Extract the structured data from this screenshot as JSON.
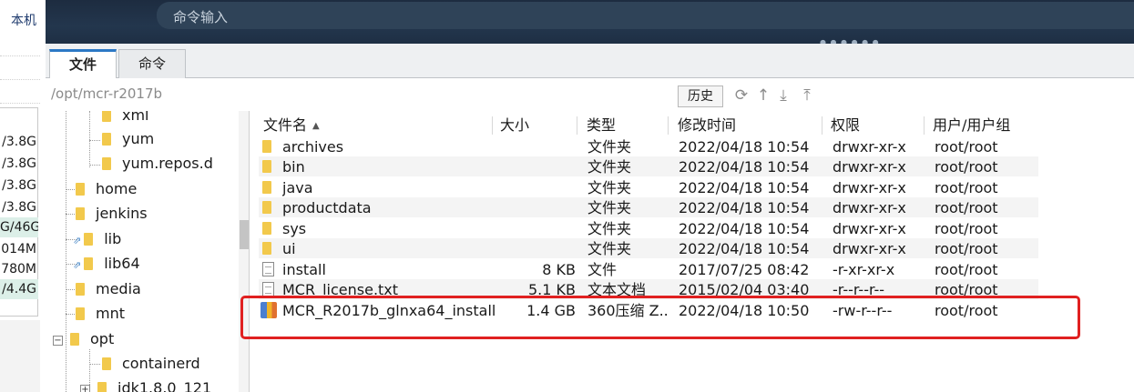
{
  "left_panel": {
    "label": "本机",
    "rows": [
      "/3.8G",
      "/3.8G",
      "/3.8G",
      "/3.8G",
      "G/46G",
      "014M",
      "780M",
      "/4.4G"
    ]
  },
  "command_bar": {
    "placeholder": "命令输入"
  },
  "tabs": [
    {
      "label": "文件",
      "active": true
    },
    {
      "label": "命令",
      "active": false
    }
  ],
  "path": {
    "current": "/opt/mcr-r2017b",
    "history_label": "历史",
    "tool_icons": [
      "refresh-icon",
      "up-directory-icon",
      "download-icon",
      "upload-icon"
    ]
  },
  "tree": [
    {
      "label": "xml",
      "level": 2,
      "kind": "folder"
    },
    {
      "label": "yum",
      "level": 2,
      "kind": "folder"
    },
    {
      "label": "yum.repos.d",
      "level": 2,
      "kind": "folder"
    },
    {
      "label": "home",
      "level": 1,
      "kind": "folder"
    },
    {
      "label": "jenkins",
      "level": 1,
      "kind": "folder"
    },
    {
      "label": "lib",
      "level": 1,
      "kind": "link"
    },
    {
      "label": "lib64",
      "level": 1,
      "kind": "link"
    },
    {
      "label": "media",
      "level": 1,
      "kind": "folder"
    },
    {
      "label": "mnt",
      "level": 1,
      "kind": "folder"
    },
    {
      "label": "opt",
      "level": 1,
      "kind": "folder-expanded"
    },
    {
      "label": "containerd",
      "level": 2,
      "kind": "folder"
    },
    {
      "label": "jdk1.8.0_121",
      "level": 2,
      "kind": "folder-collapsed"
    }
  ],
  "file_table": {
    "columns": [
      "文件名",
      "大小",
      "类型",
      "修改时间",
      "权限",
      "用户/用户组"
    ],
    "rows": [
      {
        "icon": "folder",
        "name": "archives",
        "size": "",
        "type": "文件夹",
        "mtime": "2022/04/18 10:54",
        "perm": "drwxr-xr-x",
        "owner": "root/root"
      },
      {
        "icon": "folder",
        "name": "bin",
        "size": "",
        "type": "文件夹",
        "mtime": "2022/04/18 10:54",
        "perm": "drwxr-xr-x",
        "owner": "root/root"
      },
      {
        "icon": "folder",
        "name": "java",
        "size": "",
        "type": "文件夹",
        "mtime": "2022/04/18 10:54",
        "perm": "drwxr-xr-x",
        "owner": "root/root"
      },
      {
        "icon": "folder",
        "name": "productdata",
        "size": "",
        "type": "文件夹",
        "mtime": "2022/04/18 10:54",
        "perm": "drwxr-xr-x",
        "owner": "root/root"
      },
      {
        "icon": "folder",
        "name": "sys",
        "size": "",
        "type": "文件夹",
        "mtime": "2022/04/18 10:54",
        "perm": "drwxr-xr-x",
        "owner": "root/root"
      },
      {
        "icon": "folder",
        "name": "ui",
        "size": "",
        "type": "文件夹",
        "mtime": "2022/04/18 10:54",
        "perm": "drwxr-xr-x",
        "owner": "root/root"
      },
      {
        "icon": "doc",
        "name": "install",
        "size": "8 KB",
        "type": "文件",
        "mtime": "2017/07/25 08:42",
        "perm": "-r-xr-xr-x",
        "owner": "root/root"
      },
      {
        "icon": "doc",
        "name": "MCR_license.txt",
        "size": "5.1 KB",
        "type": "文本文档",
        "mtime": "2015/02/04 03:40",
        "perm": "-r--r--r--",
        "owner": "root/root"
      },
      {
        "icon": "zip",
        "name": "MCR_R2017b_glnxa64_install...",
        "size": "1.4 GB",
        "type": "360压缩 Z...",
        "mtime": "2022/04/18 10:50",
        "perm": "-rw-r--r--",
        "owner": "root/root"
      }
    ]
  },
  "colors": {
    "highlight_box": "#e02020",
    "tab_accent": "#2b78c5",
    "folder": "#f2c94c",
    "top_bar": "#1f3046"
  }
}
